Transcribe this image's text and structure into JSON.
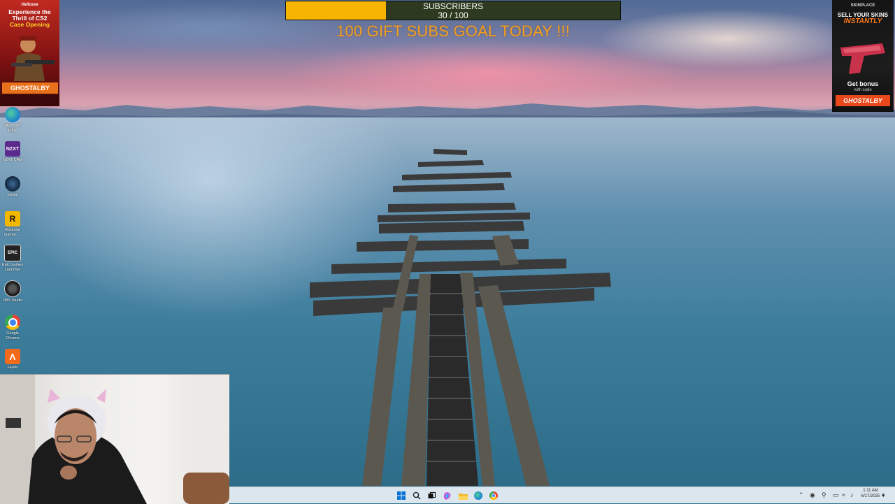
{
  "overlay": {
    "subscribers_label": "SUBSCRIBERS",
    "subscribers_count": "30 / 100",
    "subscribers_progress": 0.3,
    "goal_text": "100 GIFT SUBS GOAL TODAY !!!",
    "fill_color": "#f7b400",
    "goal_color": "#f0a020"
  },
  "ad_left": {
    "brand": "Hellcase",
    "headline_1": "Experience the",
    "headline_2": "Thrill of CS2",
    "headline_3": "Case Opening",
    "code": "GHOSTALBY"
  },
  "ad_right": {
    "brand": "SKINPLACE",
    "headline_1": "SELL YOUR SKINS",
    "headline_2": "INSTANTLY",
    "bonus": "Get bonus",
    "with_code": "with code",
    "code": "GHOSTALBY"
  },
  "desktop_icons": [
    {
      "label": "Microsoft Edge",
      "icon": "edge-icon"
    },
    {
      "label": "NZXT CAM",
      "icon": "nzxt-icon",
      "glyph": "NZXT"
    },
    {
      "label": "Steam",
      "icon": "steam-icon"
    },
    {
      "label": "Rockstar Games ...",
      "icon": "rockstar-icon",
      "glyph": "R"
    },
    {
      "label": "Epic Games Launcher",
      "icon": "epic-icon",
      "glyph": "EPIC"
    },
    {
      "label": "OBS Studio",
      "icon": "obs-icon"
    },
    {
      "label": "Google Chrome",
      "icon": "chrome-icon"
    },
    {
      "label": "FiveM",
      "icon": "fivem-icon"
    }
  ],
  "taskbar": {
    "apps": [
      "start-icon",
      "search-icon",
      "task-view-icon",
      "copilot-icon",
      "file-explorer-icon",
      "edge-icon",
      "chrome-icon"
    ],
    "time": "1:11 AM",
    "date": "6/17/2025"
  }
}
